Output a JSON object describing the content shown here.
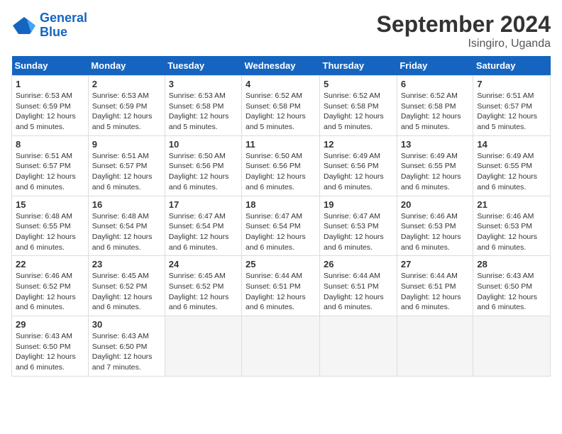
{
  "header": {
    "logo_line1": "General",
    "logo_line2": "Blue",
    "month": "September 2024",
    "location": "Isingiro, Uganda"
  },
  "weekdays": [
    "Sunday",
    "Monday",
    "Tuesday",
    "Wednesday",
    "Thursday",
    "Friday",
    "Saturday"
  ],
  "weeks": [
    [
      {
        "day": "1",
        "rise": "6:53 AM",
        "set": "6:59 PM",
        "daylight": "12 hours and 5 minutes."
      },
      {
        "day": "2",
        "rise": "6:53 AM",
        "set": "6:59 PM",
        "daylight": "12 hours and 5 minutes."
      },
      {
        "day": "3",
        "rise": "6:53 AM",
        "set": "6:58 PM",
        "daylight": "12 hours and 5 minutes."
      },
      {
        "day": "4",
        "rise": "6:52 AM",
        "set": "6:58 PM",
        "daylight": "12 hours and 5 minutes."
      },
      {
        "day": "5",
        "rise": "6:52 AM",
        "set": "6:58 PM",
        "daylight": "12 hours and 5 minutes."
      },
      {
        "day": "6",
        "rise": "6:52 AM",
        "set": "6:58 PM",
        "daylight": "12 hours and 5 minutes."
      },
      {
        "day": "7",
        "rise": "6:51 AM",
        "set": "6:57 PM",
        "daylight": "12 hours and 5 minutes."
      }
    ],
    [
      {
        "day": "8",
        "rise": "6:51 AM",
        "set": "6:57 PM",
        "daylight": "12 hours and 6 minutes."
      },
      {
        "day": "9",
        "rise": "6:51 AM",
        "set": "6:57 PM",
        "daylight": "12 hours and 6 minutes."
      },
      {
        "day": "10",
        "rise": "6:50 AM",
        "set": "6:56 PM",
        "daylight": "12 hours and 6 minutes."
      },
      {
        "day": "11",
        "rise": "6:50 AM",
        "set": "6:56 PM",
        "daylight": "12 hours and 6 minutes."
      },
      {
        "day": "12",
        "rise": "6:49 AM",
        "set": "6:56 PM",
        "daylight": "12 hours and 6 minutes."
      },
      {
        "day": "13",
        "rise": "6:49 AM",
        "set": "6:55 PM",
        "daylight": "12 hours and 6 minutes."
      },
      {
        "day": "14",
        "rise": "6:49 AM",
        "set": "6:55 PM",
        "daylight": "12 hours and 6 minutes."
      }
    ],
    [
      {
        "day": "15",
        "rise": "6:48 AM",
        "set": "6:55 PM",
        "daylight": "12 hours and 6 minutes."
      },
      {
        "day": "16",
        "rise": "6:48 AM",
        "set": "6:54 PM",
        "daylight": "12 hours and 6 minutes."
      },
      {
        "day": "17",
        "rise": "6:47 AM",
        "set": "6:54 PM",
        "daylight": "12 hours and 6 minutes."
      },
      {
        "day": "18",
        "rise": "6:47 AM",
        "set": "6:54 PM",
        "daylight": "12 hours and 6 minutes."
      },
      {
        "day": "19",
        "rise": "6:47 AM",
        "set": "6:53 PM",
        "daylight": "12 hours and 6 minutes."
      },
      {
        "day": "20",
        "rise": "6:46 AM",
        "set": "6:53 PM",
        "daylight": "12 hours and 6 minutes."
      },
      {
        "day": "21",
        "rise": "6:46 AM",
        "set": "6:53 PM",
        "daylight": "12 hours and 6 minutes."
      }
    ],
    [
      {
        "day": "22",
        "rise": "6:46 AM",
        "set": "6:52 PM",
        "daylight": "12 hours and 6 minutes."
      },
      {
        "day": "23",
        "rise": "6:45 AM",
        "set": "6:52 PM",
        "daylight": "12 hours and 6 minutes."
      },
      {
        "day": "24",
        "rise": "6:45 AM",
        "set": "6:52 PM",
        "daylight": "12 hours and 6 minutes."
      },
      {
        "day": "25",
        "rise": "6:44 AM",
        "set": "6:51 PM",
        "daylight": "12 hours and 6 minutes."
      },
      {
        "day": "26",
        "rise": "6:44 AM",
        "set": "6:51 PM",
        "daylight": "12 hours and 6 minutes."
      },
      {
        "day": "27",
        "rise": "6:44 AM",
        "set": "6:51 PM",
        "daylight": "12 hours and 6 minutes."
      },
      {
        "day": "28",
        "rise": "6:43 AM",
        "set": "6:50 PM",
        "daylight": "12 hours and 6 minutes."
      }
    ],
    [
      {
        "day": "29",
        "rise": "6:43 AM",
        "set": "6:50 PM",
        "daylight": "12 hours and 6 minutes."
      },
      {
        "day": "30",
        "rise": "6:43 AM",
        "set": "6:50 PM",
        "daylight": "12 hours and 7 minutes."
      },
      null,
      null,
      null,
      null,
      null
    ]
  ]
}
